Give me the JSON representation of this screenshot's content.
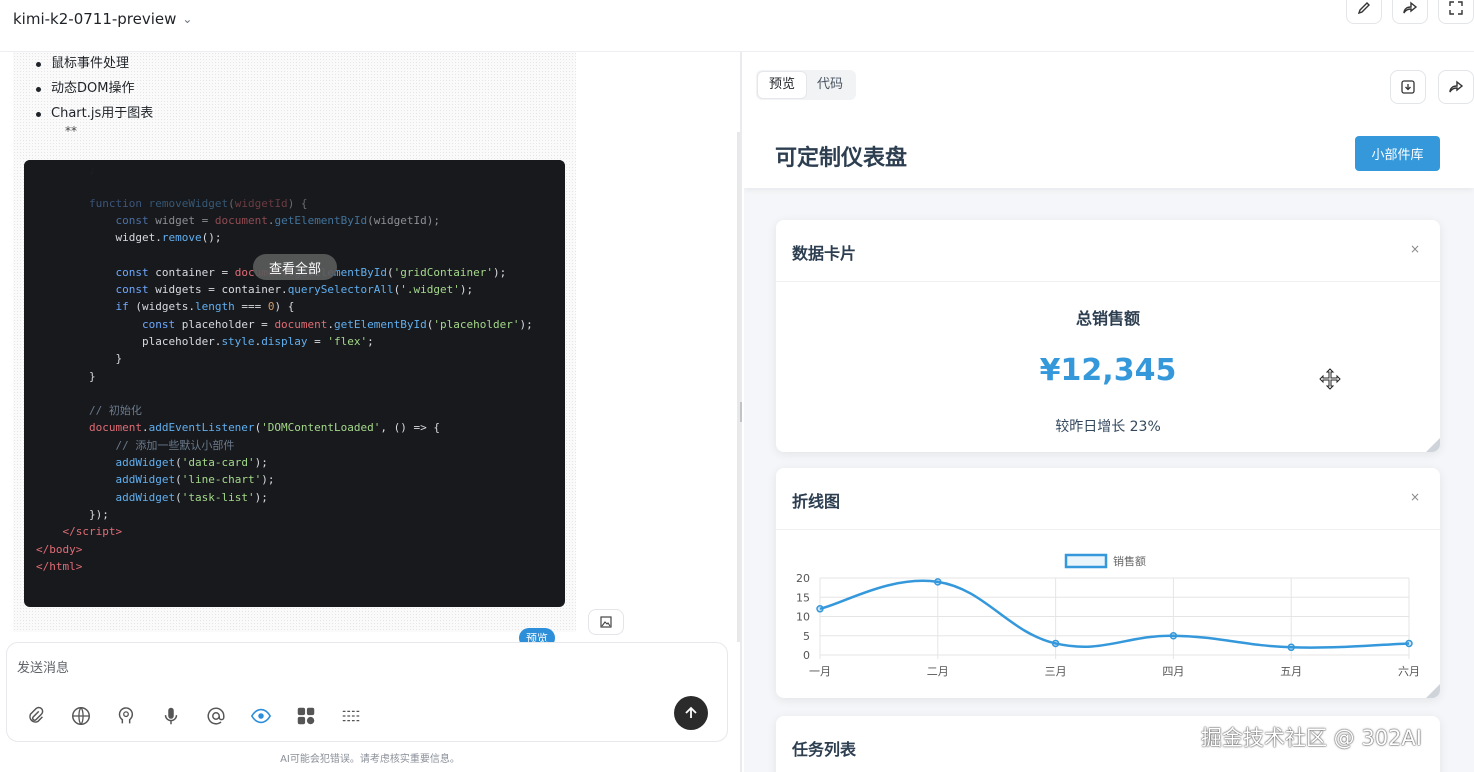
{
  "topbar": {
    "model_name": "kimi-k2-0711-preview",
    "actions": [
      "edit-icon",
      "share-icon",
      "fullscreen-icon"
    ]
  },
  "chat": {
    "bullets": [
      "鼠标事件处理",
      "动态DOM操作",
      "Chart.js用于图表"
    ],
    "stars": "**",
    "view_all_label": "查看全部",
    "preview_badge": "预览",
    "input_placeholder": "发送消息",
    "tools": [
      "paperclip-icon",
      "globe-icon",
      "brain-icon",
      "mic-icon",
      "at-icon",
      "eye-icon",
      "apps-icon",
      "sliders-icon"
    ],
    "disclaimer": "AI可能会犯错误。请考虑核实重要信息。"
  },
  "preview": {
    "tabs": [
      {
        "label": "预览",
        "active": true
      },
      {
        "label": "代码",
        "active": false
      }
    ],
    "dashboard": {
      "title": "可定制仪表盘",
      "library_button": "小部件库",
      "widgets": [
        {
          "title": "数据卡片",
          "close": "×",
          "kpi_label": "总销售额",
          "kpi_value": "¥12,345",
          "kpi_sub": "较昨日增长 23%"
        },
        {
          "title": "折线图",
          "close": "×"
        },
        {
          "title": "任务列表"
        }
      ]
    }
  },
  "chart_data": {
    "type": "line",
    "categories": [
      "一月",
      "二月",
      "三月",
      "四月",
      "五月",
      "六月"
    ],
    "series": [
      {
        "name": "销售额",
        "values": [
          12,
          19,
          3,
          5,
          2,
          3
        ],
        "color": "#3498db"
      }
    ],
    "ylim": [
      0,
      20
    ],
    "yticks": [
      0,
      5,
      10,
      15,
      20
    ],
    "legend": "top-center",
    "grid": true
  },
  "watermark": "掘金技术社区 @ 302AI"
}
